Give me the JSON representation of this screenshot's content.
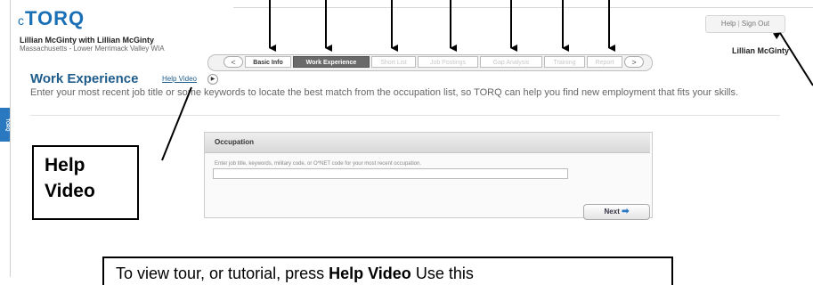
{
  "app": {
    "logo_prefix": "c",
    "logo": "TORQ",
    "user_line1": "Lillian McGinty with Lillian McGinty",
    "user_line2": "Massachusetts - Lower Merrimack Valley WIA",
    "user_right": "Lillian McGinty",
    "top_links": {
      "help": "Help",
      "sep": "|",
      "sign_out": "Sign Out"
    }
  },
  "stepper": {
    "prev": "<",
    "next": ">",
    "steps": [
      {
        "label": "Basic Info",
        "state": "done"
      },
      {
        "label": "Work Experience",
        "state": "active"
      },
      {
        "label": "Short List",
        "state": "disabled"
      },
      {
        "label": "Job Postings",
        "state": "disabled"
      },
      {
        "label": "Gap Analysis",
        "state": "disabled"
      },
      {
        "label": "Training",
        "state": "disabled"
      },
      {
        "label": "Report",
        "state": "disabled"
      }
    ]
  },
  "page": {
    "title": "Work Experience",
    "help_link": "Help Video",
    "play_icon": "play-icon",
    "intro": "Enter your most recent job title or some keywords to locate the best match from the occupation list, so TORQ can help you find new employment that fits your skills."
  },
  "side_tab": "TORQ",
  "occupation": {
    "header": "Occupation",
    "hint": "Enter job title, keywords, military code, or O*NET code for your most recent occupation.",
    "value": "",
    "next_label": "Next",
    "next_icon": "arrow-right-icon"
  },
  "annotations": {
    "callout_line1": "Help",
    "callout_line2": "Video",
    "bottom_part1": "To view tour, or tutorial, press ",
    "bottom_bold": "Help Video",
    "bottom_part2": "  Use this",
    "arrow_color": "#000000"
  },
  "colors": {
    "brand": "#1a6fb5",
    "title": "#1f5d8c",
    "active_step": "#6a6a6a"
  }
}
